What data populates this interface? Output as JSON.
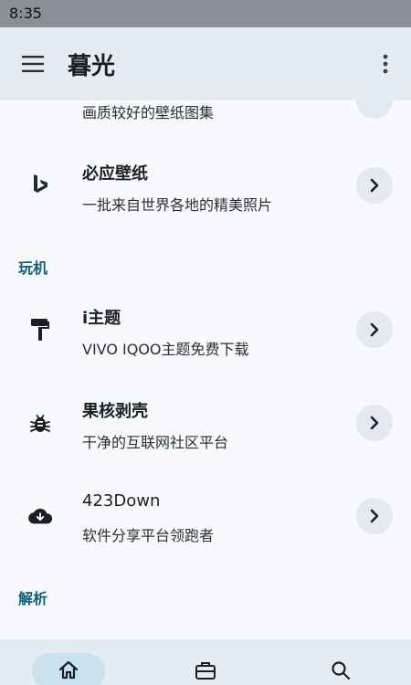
{
  "status_bar": {
    "time": "8:35"
  },
  "app_bar": {
    "title": "暮光"
  },
  "partial_item": {
    "subtitle": "画质较好的壁纸图集"
  },
  "sections": [
    {
      "header": "",
      "items": [
        {
          "title": "必应壁纸",
          "subtitle": "一批来自世界各地的精美照片",
          "icon": "bing-icon"
        }
      ]
    },
    {
      "header": "玩机",
      "items": [
        {
          "title": "i主题",
          "subtitle": "VIVO IQOO主题免费下载",
          "icon": "paint-roller-icon"
        },
        {
          "title": "果核剥壳",
          "subtitle": "干净的互联网社区平台",
          "icon": "bug-icon"
        },
        {
          "title": "423Down",
          "subtitle": "软件分享平台领跑者",
          "icon": "cloud-download-icon"
        }
      ]
    },
    {
      "header": "解析",
      "items": []
    }
  ],
  "bottom_nav": {
    "items": [
      {
        "icon": "home-icon",
        "active": true
      },
      {
        "icon": "toolbox-icon",
        "active": false
      },
      {
        "icon": "search-icon",
        "active": false
      }
    ]
  },
  "colors": {
    "accent": "#0e5f7a",
    "app_bar_bg": "#e4ecf2",
    "chevron_bg": "#e2e9ef",
    "nav_active_bg": "#c9e2f0"
  }
}
